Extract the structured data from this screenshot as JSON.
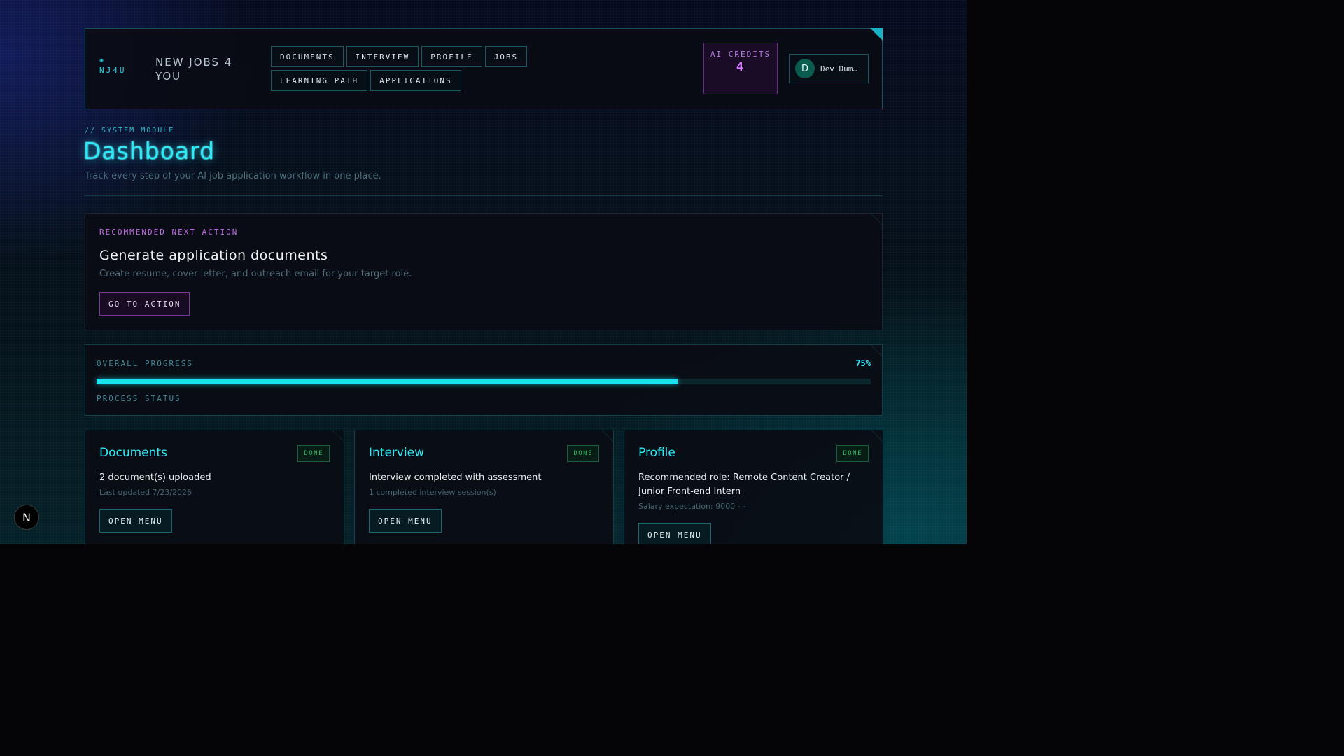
{
  "header": {
    "logo_text": "NJ4U",
    "brand": "NEW JOBS 4 YOU",
    "nav": [
      "DOCUMENTS",
      "INTERVIEW",
      "PROFILE",
      "JOBS",
      "LEARNING PATH",
      "APPLICATIONS"
    ],
    "credits_label": "AI CREDITS",
    "credits_value": "4",
    "user_initial": "D",
    "user_name": "Dev Dum…"
  },
  "page": {
    "module_label": "// SYSTEM MODULE",
    "title": "Dashboard",
    "subtitle": "Track every step of your AI job application workflow in one place."
  },
  "recommended": {
    "kicker": "RECOMMENDED NEXT ACTION",
    "title": "Generate application documents",
    "description": "Create resume, cover letter, and outreach email for your target role.",
    "button": "GO TO ACTION"
  },
  "progress": {
    "label": "OVERALL PROGRESS",
    "percent_text": "75%",
    "fraction": 0.75,
    "status_label": "PROCESS STATUS"
  },
  "cards": [
    {
      "title": "Documents",
      "badge": "DONE",
      "main": "2 document(s) uploaded",
      "sub": "Last updated 7/23/2026",
      "button": "OPEN MENU"
    },
    {
      "title": "Interview",
      "badge": "DONE",
      "main": "Interview completed with assessment",
      "sub": "1 completed interview session(s)",
      "button": "OPEN MENU"
    },
    {
      "title": "Profile",
      "badge": "DONE",
      "main": "Recommended role: Remote Content Creator / Junior Front-end Intern",
      "sub": "Salary expectation: 9000 - -",
      "button": "OPEN MENU"
    }
  ],
  "dev_badge": "N",
  "colors": {
    "accent": "#2ee9f7",
    "purple": "#c46be8",
    "done": "#28b861"
  }
}
